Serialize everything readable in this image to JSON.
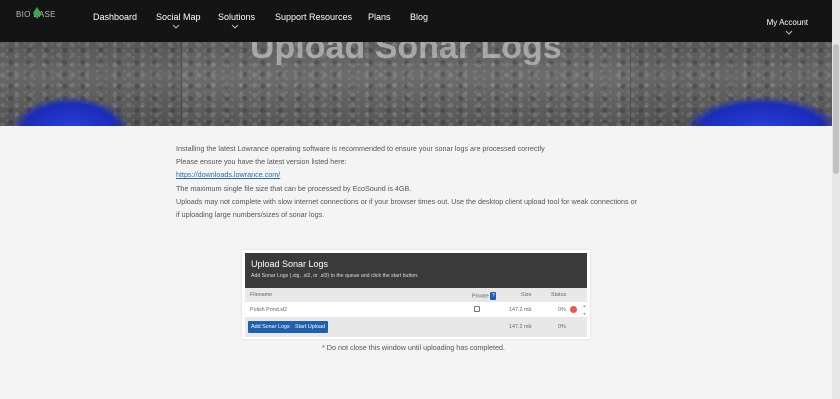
{
  "nav": {
    "logo_text": "BIO BASE",
    "items": [
      {
        "label": "Dashboard",
        "has_dropdown": false
      },
      {
        "label": "Social Map",
        "has_dropdown": true
      },
      {
        "label": "Solutions",
        "has_dropdown": true
      },
      {
        "label": "Support Resources",
        "has_dropdown": false
      },
      {
        "label": "Plans",
        "has_dropdown": false
      },
      {
        "label": "Blog",
        "has_dropdown": false
      }
    ],
    "account_label": "My Account"
  },
  "hero": {
    "title": "Upload Sonar Logs"
  },
  "info": {
    "line1": "Installing the latest Lowrance operating software is recommended to ensure your sonar logs are processed correctly",
    "line2": "Please ensure you have the latest version listed here:",
    "link": "https://downloads.lowrance.com/",
    "line3": "The maximum single file size that can be processed by EcoSound is 4GB.",
    "line4": "Uploads may not complete with slow internet connections or if your browser times out. Use the desktop client upload tool for weak connections or",
    "line5": "if uploading large numbers/sizes of sonar logs."
  },
  "uploader": {
    "title": "Upload Sonar Logs",
    "subtitle": "Add Sonar Logs (.slg, .sl2, or .sl3) to the queue and click the start button.",
    "columns": {
      "filename": "Filename",
      "private": "Private",
      "private_badge": "?",
      "size": "Size",
      "status": "Status"
    },
    "files": [
      {
        "filename": "Polish Pond.sl2",
        "size": "147.2 mb",
        "status": "0%"
      }
    ],
    "footer": {
      "total_size": "147.2 mb",
      "total_status": "0%"
    },
    "buttons": {
      "add": "Add Sonar Logs",
      "start": "Start Upload"
    }
  },
  "note": "* Do not close this window until uploading has completed.",
  "colors": {
    "accent": "#1e5fb0",
    "nav_bg": "#141414",
    "remove": "#ee5555"
  }
}
